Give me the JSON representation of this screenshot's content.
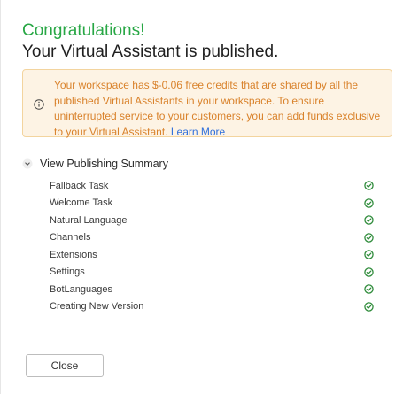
{
  "header": {
    "success_text": "Congratulations!",
    "title": "Your Virtual Assistant is published."
  },
  "alert": {
    "icon": "info-icon",
    "message": "Your workspace has $-0.06 free credits that are shared by all the published Virtual Assistants in your workspace. To ensure uninterrupted service to your customers, you can add funds exclusive to your Virtual Assistant.",
    "link_text": "Learn More"
  },
  "summary": {
    "toggle_label": "View Publishing Summary",
    "toggle_icon": "chevron-down-icon",
    "items": [
      {
        "label": "Fallback Task",
        "status_icon": "check-circle-icon"
      },
      {
        "label": "Welcome Task",
        "status_icon": "check-circle-icon"
      },
      {
        "label": "Natural Language",
        "status_icon": "check-circle-icon"
      },
      {
        "label": "Channels",
        "status_icon": "check-circle-icon"
      },
      {
        "label": "Extensions",
        "status_icon": "check-circle-icon"
      },
      {
        "label": "Settings",
        "status_icon": "check-circle-icon"
      },
      {
        "label": "BotLanguages",
        "status_icon": "check-circle-icon"
      },
      {
        "label": "Creating New Version",
        "status_icon": "check-circle-icon"
      }
    ]
  },
  "footer": {
    "close_label": "Close"
  },
  "colors": {
    "success": "#28a745",
    "warning_text": "#d9822b",
    "warning_bg": "#fdf3e4",
    "warning_border": "#f3d49e",
    "link": "#2f6fdb",
    "check": "#2e8b3a"
  }
}
